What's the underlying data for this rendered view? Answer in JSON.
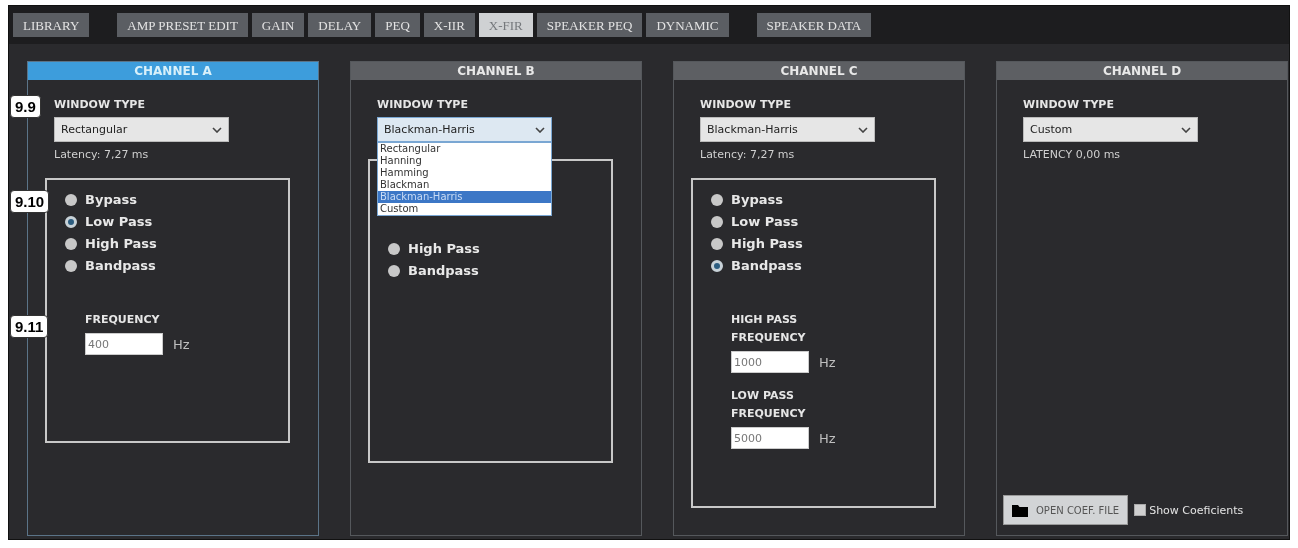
{
  "tabs": [
    {
      "label": "LIBRARY",
      "selected": false
    },
    {
      "label": "AMP PRESET EDIT",
      "selected": false
    },
    {
      "label": "GAIN",
      "selected": false
    },
    {
      "label": "DELAY",
      "selected": false
    },
    {
      "label": "PEQ",
      "selected": false
    },
    {
      "label": "X-IIR",
      "selected": false
    },
    {
      "label": "X-FIR",
      "selected": true
    },
    {
      "label": "SPEAKER PEQ",
      "selected": false
    },
    {
      "label": "DYNAMIC",
      "selected": false
    },
    {
      "label": "SPEAKER DATA",
      "selected": false
    }
  ],
  "callouts": [
    {
      "label": "9.9"
    },
    {
      "label": "9.10"
    },
    {
      "label": "9.11"
    }
  ],
  "channels": [
    {
      "name": "CHANNEL A",
      "selected": true,
      "window_label": "WINDOW TYPE",
      "window_type": "Rectangular",
      "latency": "Latency: 7,27 ms",
      "filters": [
        {
          "label": "Bypass",
          "selected": false
        },
        {
          "label": "Low Pass",
          "selected": true
        },
        {
          "label": "High Pass",
          "selected": false
        },
        {
          "label": "Bandpass",
          "selected": false
        }
      ],
      "frequencies": [
        {
          "label": "FREQUENCY",
          "value": "400",
          "unit": "Hz"
        }
      ]
    },
    {
      "name": "CHANNEL B",
      "selected": false,
      "window_label": "WINDOW TYPE",
      "window_type": "Blackman-Harris",
      "dropdown_options": [
        {
          "label": "Rectangular",
          "selected": false
        },
        {
          "label": "Hanning",
          "selected": false
        },
        {
          "label": "Hamming",
          "selected": false
        },
        {
          "label": "Blackman",
          "selected": false
        },
        {
          "label": "Blackman-Harris",
          "selected": true
        },
        {
          "label": "Custom",
          "selected": false
        }
      ],
      "filters": [
        {
          "label": "High Pass",
          "selected": false
        },
        {
          "label": "Bandpass",
          "selected": false
        }
      ]
    },
    {
      "name": "CHANNEL C",
      "selected": false,
      "window_label": "WINDOW TYPE",
      "window_type": "Blackman-Harris",
      "latency": "Latency: 7,27 ms",
      "filters": [
        {
          "label": "Bypass",
          "selected": false
        },
        {
          "label": "Low Pass",
          "selected": false
        },
        {
          "label": "High Pass",
          "selected": false
        },
        {
          "label": "Bandpass",
          "selected": true
        }
      ],
      "frequencies": [
        {
          "label": "HIGH PASS FREQUENCY",
          "value": "1000",
          "unit": "Hz"
        },
        {
          "label": "LOW PASS FREQUENCY",
          "value": "5000",
          "unit": "Hz"
        }
      ]
    },
    {
      "name": "CHANNEL D",
      "selected": false,
      "window_label": "WINDOW TYPE",
      "window_type": "Custom",
      "latency": "LATENCY 0,00 ms",
      "open_button": "OPEN COEF. FILE",
      "show_checkbox": {
        "label": "Show Coeficients",
        "checked": false
      }
    }
  ]
}
